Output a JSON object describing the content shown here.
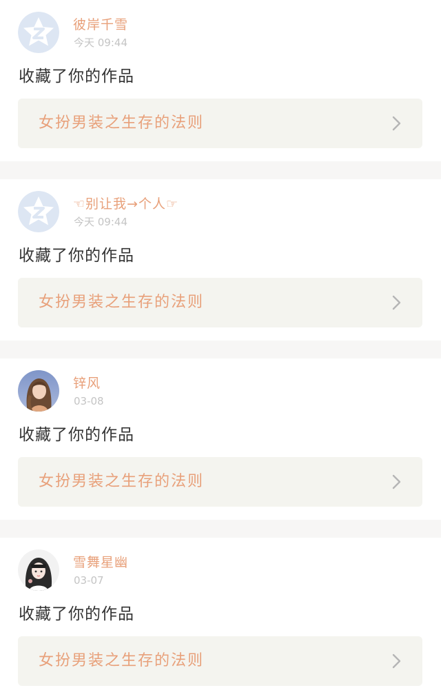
{
  "colors": {
    "username": "#e8a07a",
    "time": "#c4c4c4",
    "action_text": "#333333",
    "work_title": "#e8a07a",
    "work_card_bg": "#f4f4ef",
    "separator": "#f7f6f5",
    "chevron": "#b5b5b5",
    "default_avatar_bg": "#dde6f3"
  },
  "notifications": [
    {
      "avatar": "qq-default-avatar-icon",
      "username": "彼岸千雪",
      "time": "今天 09:44",
      "action": "收藏了你的作品",
      "work_title": "女扮男装之生存的法则"
    },
    {
      "avatar": "qq-default-avatar-icon",
      "username": "☜别让我→个人☞",
      "time": "今天 09:44",
      "action": "收藏了你的作品",
      "work_title": "女扮男装之生存的法则"
    },
    {
      "avatar": "photo-avatar-girl-long-hair",
      "username": "锌风",
      "time": "03-08",
      "action": "收藏了你的作品",
      "work_title": "女扮男装之生存的法则"
    },
    {
      "avatar": "photo-avatar-girl-white",
      "username": "雪舞星幽",
      "time": "03-07",
      "action": "收藏了你的作品",
      "work_title": "女扮男装之生存的法则"
    }
  ]
}
